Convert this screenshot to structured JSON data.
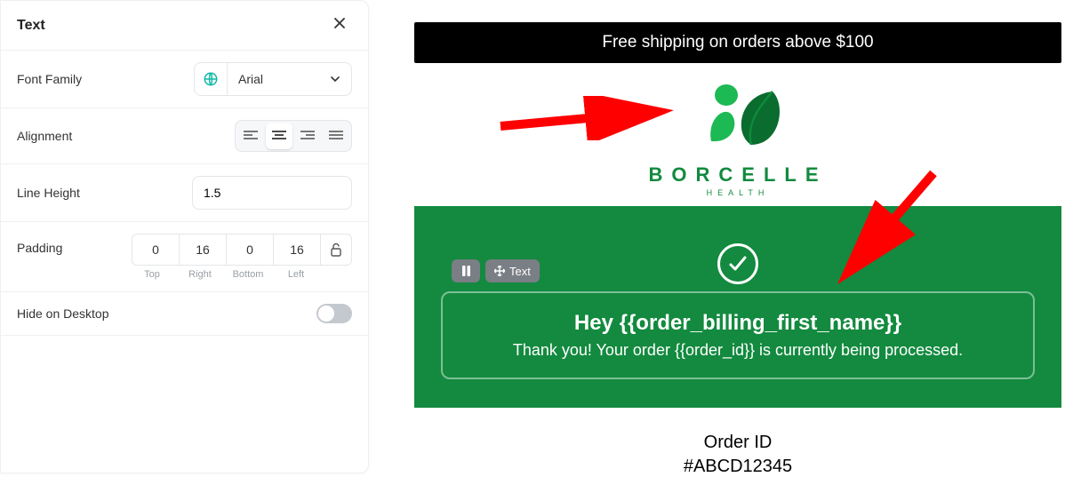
{
  "panel": {
    "title": "Text",
    "fontFamily": {
      "label": "Font Family",
      "value": "Arial"
    },
    "alignment": {
      "label": "Alignment",
      "options": [
        "left",
        "center",
        "right",
        "justify"
      ],
      "active": "center"
    },
    "lineHeight": {
      "label": "Line Height",
      "value": "1.5"
    },
    "padding": {
      "label": "Padding",
      "top": "0",
      "right": "16",
      "bottom": "0",
      "left": "16",
      "labels": {
        "top": "Top",
        "right": "Right",
        "bottom": "Bottom",
        "left": "Left"
      }
    },
    "hideOnDesktop": {
      "label": "Hide on Desktop",
      "value": false
    }
  },
  "preview": {
    "banner": "Free shipping on orders above $100",
    "brand": {
      "name": "BORCELLE",
      "sub": "HEALTH"
    },
    "block": {
      "toolbar_text_label": "Text",
      "greeting": "Hey {{order_billing_first_name}}",
      "thanks": "Thank you! Your order {{order_id}} is currently being processed."
    },
    "orderId": {
      "label": "Order ID",
      "value": "#ABCD12345"
    }
  }
}
